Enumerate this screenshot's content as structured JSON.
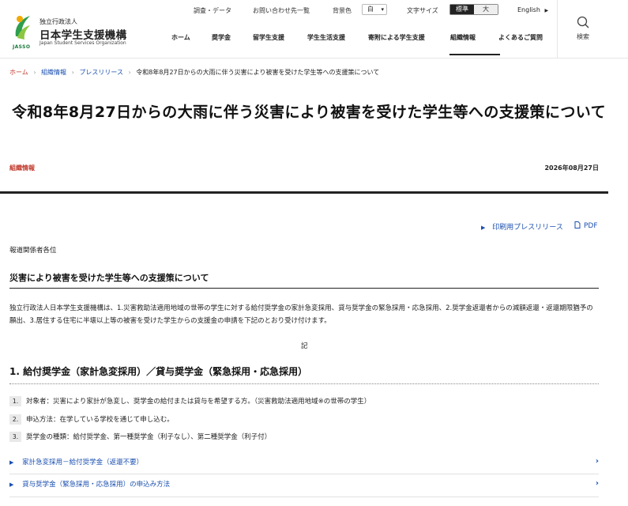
{
  "header": {
    "logo": {
      "org_small": "独立行政法人",
      "org_big": "日本学生支援機構",
      "org_en": "Japan Student Services Organization",
      "abbr": "JASSO"
    },
    "utility": {
      "survey": "調査・データ",
      "contact": "お問い合わせ先一覧",
      "bg_label": "背景色",
      "bg_value": "白",
      "font_label": "文字サイズ",
      "font_standard": "標準",
      "font_large": "大",
      "language": "English"
    },
    "nav": [
      "ホーム",
      "奨学金",
      "留学生支援",
      "学生生活支援",
      "寄附による学生支援",
      "組織情報",
      "よくあるご質問"
    ],
    "search_label": "検索"
  },
  "breadcrumb": [
    "ホーム",
    "組織情報",
    "プレスリリース",
    "令和8年8月27日からの大雨に伴う災害により被害を受けた学生等への支援策について"
  ],
  "article": {
    "title": "令和8年8月27日からの大雨に伴う災害により被害を受けた学生等への支援策について",
    "category": "組織情報",
    "date": "2026年08月27日",
    "print_link": "印刷用プレスリリース",
    "pdf_label": "PDF",
    "addressee": "報道関係者各位",
    "subheading": "災害により被害を受けた学生等への支援策について",
    "intro": "独立行政法人日本学生支援機構は、1.災害救助法適用地域の世帯の学生に対する給付奨学金の家計急変採用、貸与奨学金の緊急採用・応急採用、2.奨学金返還者からの減額返還・返還期限猶予の願出、3.居住する住宅に半壊以上等の被害を受けた学生からの支援金の申請を下記のとおり受け付けます。",
    "ki": "記",
    "section1_title": "1.  給付奨学金（家計急変採用）／貸与奨学金（緊急採用・応急採用）",
    "items": [
      {
        "num": "1.",
        "text": "対象者：災害により家計が急変し、奨学金の給付または貸与を希望する方。（災害救助法適用地域※の世帯の学生）"
      },
      {
        "num": "2.",
        "text": "申込方法：在学している学校を通じて申し込む。"
      },
      {
        "num": "3.",
        "text": "奨学金の種類：給付奨学金、第一種奨学金（利子なし）、第二種奨学金（利子付）"
      }
    ],
    "links": [
      "家計急変採用－給付奨学金（返還不要）",
      "貸与奨学金（緊急採用・応急採用）の申込み方法"
    ]
  },
  "colors": {
    "accent_red": "#c0392b",
    "link_blue": "#1a4fb0",
    "brand_green": "#1b7a3e"
  }
}
